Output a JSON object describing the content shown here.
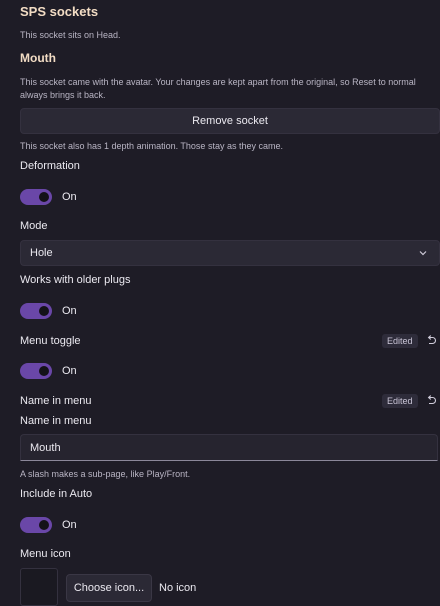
{
  "section_title": "SPS sockets",
  "socket_location": "This socket sits on Head.",
  "socket_name": "Mouth",
  "socket_note": "This socket came with the avatar. Your changes are kept apart from the original, so Reset to normal always brings it back.",
  "remove_button": "Remove socket",
  "depth_note": "This socket also has 1 depth animation. Those stay as they came.",
  "deformation": {
    "label": "Deformation",
    "state": "On",
    "on": true
  },
  "mode": {
    "label": "Mode",
    "value": "Hole"
  },
  "older_plugs": {
    "label": "Works with older plugs",
    "state": "On",
    "on": true
  },
  "menu_toggle": {
    "label": "Menu toggle",
    "badge": "Edited",
    "state": "On",
    "on": true
  },
  "name_in_menu": {
    "label": "Name in menu",
    "badge": "Edited",
    "field_label": "Name in menu",
    "value": "Mouth",
    "hint": "A slash makes a sub-page, like Play/Front."
  },
  "include_auto": {
    "label": "Include in Auto",
    "state": "On",
    "on": true
  },
  "menu_icon": {
    "label": "Menu icon",
    "choose_button": "Choose icon...",
    "status": "No icon"
  },
  "colors": {
    "accent": "#6a47a8",
    "heading": "#f2dcc4",
    "background": "#1e1c26"
  }
}
